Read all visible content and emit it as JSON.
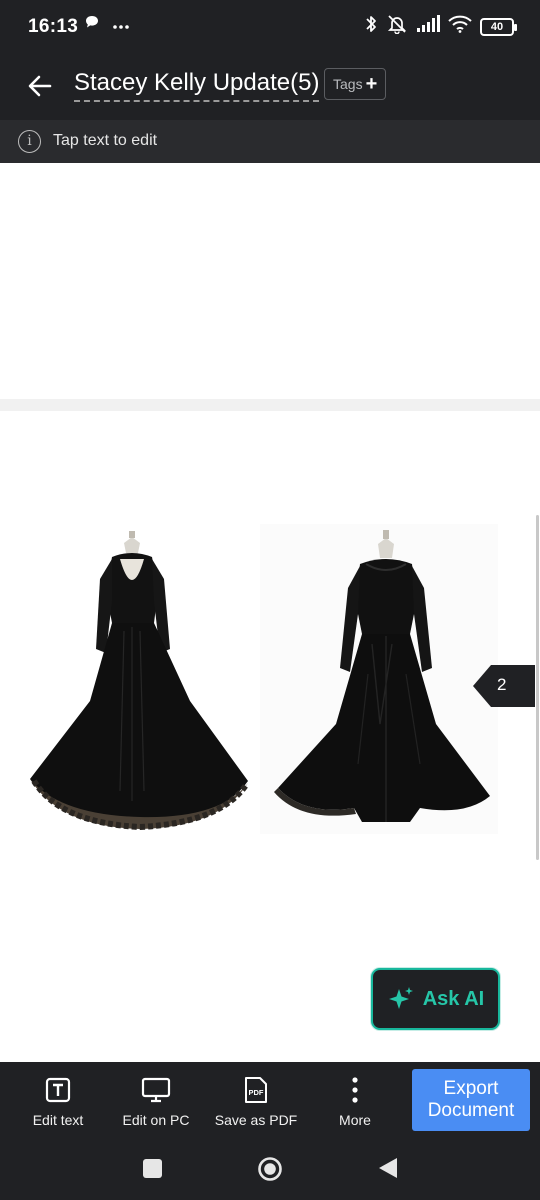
{
  "status_bar": {
    "time": "16:13",
    "notification_icons": [
      "chat-bubble-icon",
      "more-dots-icon"
    ],
    "system_icons": [
      "bluetooth-icon",
      "mute-icon",
      "signal-icon",
      "wifi-icon"
    ],
    "battery": "40"
  },
  "app_bar": {
    "back_icon": "arrow-left-icon",
    "title": "Stacey Kelly Update(5)",
    "tags_label": "Tags",
    "tags_plus": "+"
  },
  "hint": {
    "icon": "info-icon",
    "glyph": "i",
    "text": "Tap text to edit"
  },
  "document": {
    "pages": [
      {
        "content": "blank"
      },
      {
        "images": [
          "dress-back-view",
          "dress-front-view"
        ]
      }
    ],
    "page_badge": "2"
  },
  "ask_ai": {
    "icon": "sparkle-icon",
    "label": "Ask AI"
  },
  "toolbar": {
    "items": [
      {
        "label": "Edit text",
        "icon": "text-box-icon"
      },
      {
        "label": "Edit on PC",
        "icon": "monitor-icon"
      },
      {
        "label": "Save as PDF",
        "icon": "pdf-file-icon",
        "icon_text": "PDF"
      },
      {
        "label": "More",
        "icon": "more-vertical-icon"
      }
    ],
    "export": {
      "line1": "Export",
      "line2": "Document"
    }
  },
  "nav_bar": {
    "buttons": [
      "recents-square-icon",
      "home-circle-icon",
      "back-triangle-icon"
    ]
  },
  "colors": {
    "dark_bar": "#202124",
    "hint_bar": "#2a2b2e",
    "accent_teal": "#26c6a8",
    "export_blue": "#4a8df3",
    "badge": "#202124"
  }
}
